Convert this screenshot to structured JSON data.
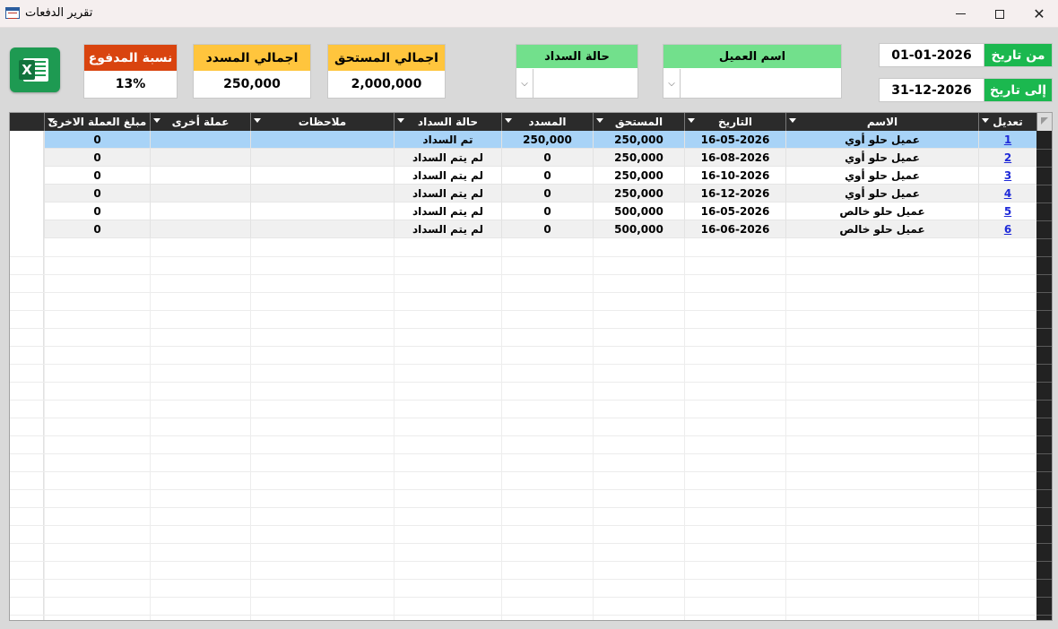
{
  "window": {
    "title": "تقرير الدفعات",
    "app_icon": "form-icon"
  },
  "stats": {
    "paid_ratio": {
      "label": "نسبة المدفوع",
      "value": "13%",
      "color": "#d9440f"
    },
    "total_paid": {
      "label": "اجمالي المسدد",
      "value": "250,000",
      "color": "#ffc53d"
    },
    "total_due": {
      "label": "اجمالي المستحق",
      "value": "2,000,000",
      "color": "#ffc53d"
    }
  },
  "filters": {
    "payment_status": {
      "label": "حالة السداد",
      "value": ""
    },
    "customer_name": {
      "label": "اسم العميل",
      "value": ""
    }
  },
  "dates": {
    "from_label": "من تاريخ",
    "from_value": "01-01-2026",
    "to_label": "إلى تاريخ",
    "to_value": "31-12-2026"
  },
  "table": {
    "columns": {
      "edit": "تعديل",
      "name": "الاسم",
      "date": "التاريخ",
      "due": "المستحق",
      "paid": "المسدد",
      "status": "حالة السداد",
      "notes": "ملاحظات",
      "other_currency": "عملة أخرى",
      "other_amount": "مبلغ العملة الاخرى"
    },
    "rows": [
      {
        "edit": "1",
        "name": "عميل حلو أوي",
        "date": "16-05-2026",
        "due": "250,000",
        "paid": "250,000",
        "status": "تم السداد",
        "notes": "",
        "other_currency": "",
        "other_amount": "0"
      },
      {
        "edit": "2",
        "name": "عميل حلو أوي",
        "date": "16-08-2026",
        "due": "250,000",
        "paid": "0",
        "status": "لم يتم السداد",
        "notes": "",
        "other_currency": "",
        "other_amount": "0"
      },
      {
        "edit": "3",
        "name": "عميل حلو أوي",
        "date": "16-10-2026",
        "due": "250,000",
        "paid": "0",
        "status": "لم يتم السداد",
        "notes": "",
        "other_currency": "",
        "other_amount": "0"
      },
      {
        "edit": "4",
        "name": "عميل حلو أوي",
        "date": "16-12-2026",
        "due": "250,000",
        "paid": "0",
        "status": "لم يتم السداد",
        "notes": "",
        "other_currency": "",
        "other_amount": "0"
      },
      {
        "edit": "5",
        "name": "عميل حلو خالص",
        "date": "16-05-2026",
        "due": "500,000",
        "paid": "0",
        "status": "لم يتم السداد",
        "notes": "",
        "other_currency": "",
        "other_amount": "0"
      },
      {
        "edit": "6",
        "name": "عميل حلو خالص",
        "date": "16-06-2026",
        "due": "500,000",
        "paid": "0",
        "status": "لم يتم السداد",
        "notes": "",
        "other_currency": "",
        "other_amount": "0"
      }
    ],
    "selected_row": 0
  }
}
